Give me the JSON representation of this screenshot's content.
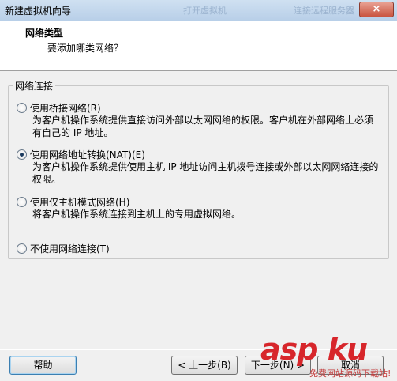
{
  "window": {
    "title": "新建虚拟机向导",
    "ghost_titles": [
      "打开虚拟机",
      "连接远程服务器"
    ],
    "close_label": "×"
  },
  "header": {
    "title": "网络类型",
    "subtitle": "要添加哪类网络？"
  },
  "group": {
    "label": "网络连接",
    "options": [
      {
        "label": "使用桥接网络(R)",
        "desc_line1": "为客户机操作系统提供直接访问外部以太网网络的权限。客户机在外部网络上必须",
        "desc_line2": "有自己的 IP 地址。",
        "checked": false
      },
      {
        "label": "使用网络地址转换(NAT)(E)",
        "desc_line1": "为客户机操作系统提供使用主机 IP 地址访问主机拨号连接或外部以太网网络连接的",
        "desc_line2": "权限。",
        "checked": true
      },
      {
        "label": "使用仅主机模式网络(H)",
        "desc_line1": "将客户机操作系统连接到主机上的专用虚拟网络。",
        "desc_line2": "",
        "checked": false
      },
      {
        "label": "不使用网络连接(T)",
        "desc_line1": "",
        "desc_line2": "",
        "checked": false
      }
    ]
  },
  "footer": {
    "help_label": "帮助",
    "back_label": "< 上一步(B)",
    "next_label": "下一步(N) >",
    "cancel_label": "取消"
  },
  "watermark": {
    "logo_text": "asp ku",
    "caption": "免费网站源码下载站!"
  },
  "colors": {
    "title_bar": "#b8cfe8",
    "close_button": "#c9543f",
    "watermark": "#d7262b"
  }
}
